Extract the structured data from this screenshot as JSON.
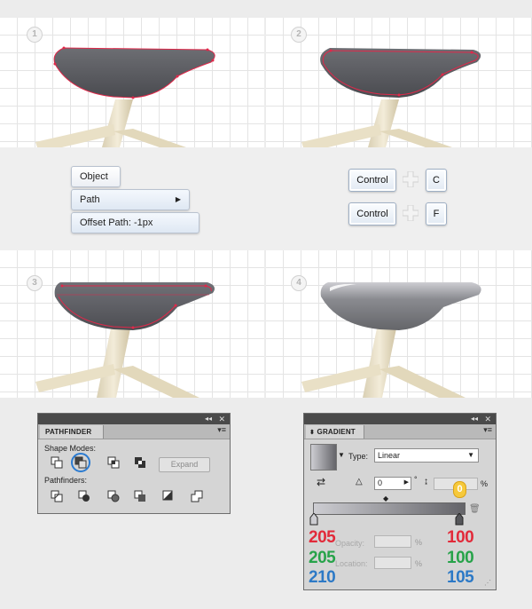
{
  "steps": [
    "1",
    "2",
    "3",
    "4"
  ],
  "menu": {
    "object": "Object",
    "path": "Path",
    "offset_path": "Offset Path: -1px"
  },
  "shortcuts": [
    {
      "modifier": "Control",
      "key": "C"
    },
    {
      "modifier": "Control",
      "key": "F"
    }
  ],
  "pathfinder": {
    "title": "PATHFINDER",
    "shape_modes_label": "Shape Modes:",
    "pathfinders_label": "Pathfinders:",
    "expand_label": "Expand",
    "shape_mode_icons": [
      "unite-icon",
      "minus-front-icon",
      "intersect-icon",
      "exclude-icon"
    ],
    "pathfinder_icons": [
      "divide-icon",
      "trim-icon",
      "merge-icon",
      "crop-icon",
      "outline-icon",
      "minus-back-icon"
    ]
  },
  "gradient": {
    "title": "GRADIENT",
    "type_label": "Type:",
    "type_value": "Linear",
    "angle_value": "0",
    "degree_symbol": "°",
    "percent_symbol": "%",
    "opacity_label": "Opacity:",
    "location_label": "Location:",
    "left_stop": {
      "r": "205",
      "g": "205",
      "b": "210"
    },
    "right_stop": {
      "r": "100",
      "g": "100",
      "b": "105"
    },
    "highlight_badge": "0"
  },
  "colors": {
    "red": "#e22a3a",
    "green": "#27a34a",
    "blue": "#2c79c6",
    "path": "#e0284a"
  }
}
